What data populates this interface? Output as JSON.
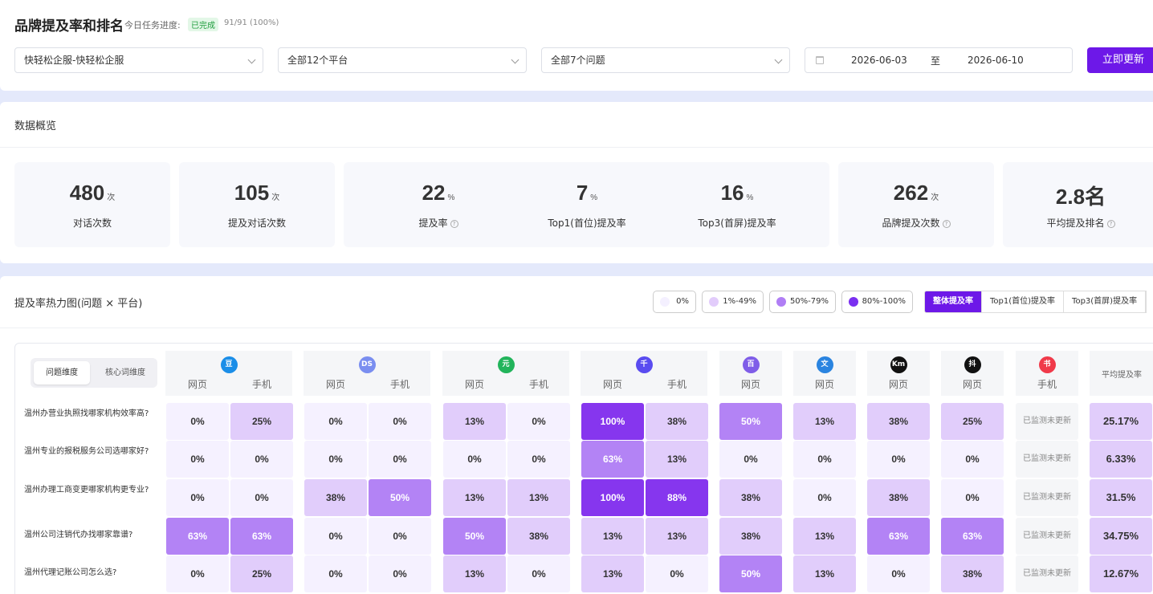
{
  "header": {
    "title": "品牌提及率和排名",
    "progress_label": "今日任务进度:",
    "status": "已完成",
    "progress": "91/91 (100%)"
  },
  "filters": {
    "brand": "快轻松企服-快轻松企服",
    "platform": "全部12个平台",
    "question": "全部7个问题",
    "date_start": "2026-06-03",
    "date_sep": "至",
    "date_end": "2026-06-10",
    "update_button": "立即更新"
  },
  "overview": {
    "title": "数据概览",
    "stats": [
      {
        "value": "480",
        "unit": "次",
        "label": "对话次数",
        "help": false
      },
      {
        "value": "105",
        "unit": "次",
        "label": "提及对话次数",
        "help": false
      },
      {
        "value": "22",
        "unit": "%",
        "label": "提及率",
        "help": true
      },
      {
        "value": "7",
        "unit": "%",
        "label": "Top1(首位)提及率",
        "help": false
      },
      {
        "value": "16",
        "unit": "%",
        "label": "Top3(首屏)提及率",
        "help": false
      },
      {
        "value": "262",
        "unit": "次",
        "label": "品牌提及次数",
        "help": true
      },
      {
        "value": "2.8名",
        "unit": "",
        "label": "平均提及排名",
        "help": true
      }
    ]
  },
  "heatmap": {
    "title": "提及率热力图(问题 × 平台)",
    "legend": [
      {
        "label": "0%",
        "color": "#f4f0ff"
      },
      {
        "label": "1%-49%",
        "color": "#e2ccfb"
      },
      {
        "label": "50%-79%",
        "color": "#b07ef5"
      },
      {
        "label": "80%-100%",
        "color": "#7a2ff0"
      }
    ],
    "tabs": [
      "整体提及率",
      "Top1(首位)提及率",
      "Top3(首屏)提及率"
    ],
    "toggle": [
      "问题维度",
      "核心词维度"
    ],
    "platforms": [
      {
        "icon": "豆",
        "color": "#1b8ee8",
        "subs": [
          "网页",
          "手机"
        ]
      },
      {
        "icon": "DS",
        "color": "#7a8ef0",
        "subs": [
          "网页",
          "手机"
        ]
      },
      {
        "icon": "元",
        "color": "#22b45b",
        "subs": [
          "网页",
          "手机"
        ]
      },
      {
        "icon": "千",
        "color": "#5a4cf0",
        "subs": [
          "网页",
          "手机"
        ]
      },
      {
        "icon": "百",
        "color": "#7f5de8",
        "subs": [
          "网页"
        ]
      },
      {
        "icon": "文",
        "color": "#2a84e0",
        "subs": [
          "网页"
        ]
      },
      {
        "icon": "Km",
        "color": "#111111",
        "subs": [
          "网页"
        ]
      },
      {
        "icon": "抖",
        "color": "#111111",
        "subs": [
          "网页"
        ]
      },
      {
        "icon": "书",
        "color": "#f03a4a",
        "subs": [
          "手机"
        ]
      }
    ],
    "avg_header": "平均提及率",
    "not_updated": "已监测未更新",
    "rows": [
      {
        "q": "温州办营业执照找哪家机构效率高?",
        "v": [
          "0%",
          "25%",
          "0%",
          "0%",
          "13%",
          "0%",
          "100%",
          "38%",
          "50%",
          "13%",
          "38%",
          "25%"
        ],
        "avg": "25.17%"
      },
      {
        "q": "温州专业的报税服务公司选哪家好?",
        "v": [
          "0%",
          "0%",
          "0%",
          "0%",
          "0%",
          "0%",
          "63%",
          "13%",
          "0%",
          "0%",
          "0%",
          "0%"
        ],
        "avg": "6.33%"
      },
      {
        "q": "温州办理工商变更哪家机构更专业?",
        "v": [
          "0%",
          "0%",
          "38%",
          "50%",
          "13%",
          "13%",
          "100%",
          "88%",
          "38%",
          "0%",
          "38%",
          "0%"
        ],
        "avg": "31.5%"
      },
      {
        "q": "温州公司注销代办找哪家靠谱?",
        "v": [
          "63%",
          "63%",
          "0%",
          "0%",
          "50%",
          "38%",
          "13%",
          "13%",
          "38%",
          "13%",
          "63%",
          "63%"
        ],
        "avg": "34.75%"
      },
      {
        "q": "温州代理记账公司怎么选?",
        "v": [
          "0%",
          "25%",
          "0%",
          "0%",
          "13%",
          "0%",
          "13%",
          "0%",
          "50%",
          "13%",
          "0%",
          "38%"
        ],
        "avg": "12.67%"
      }
    ]
  }
}
